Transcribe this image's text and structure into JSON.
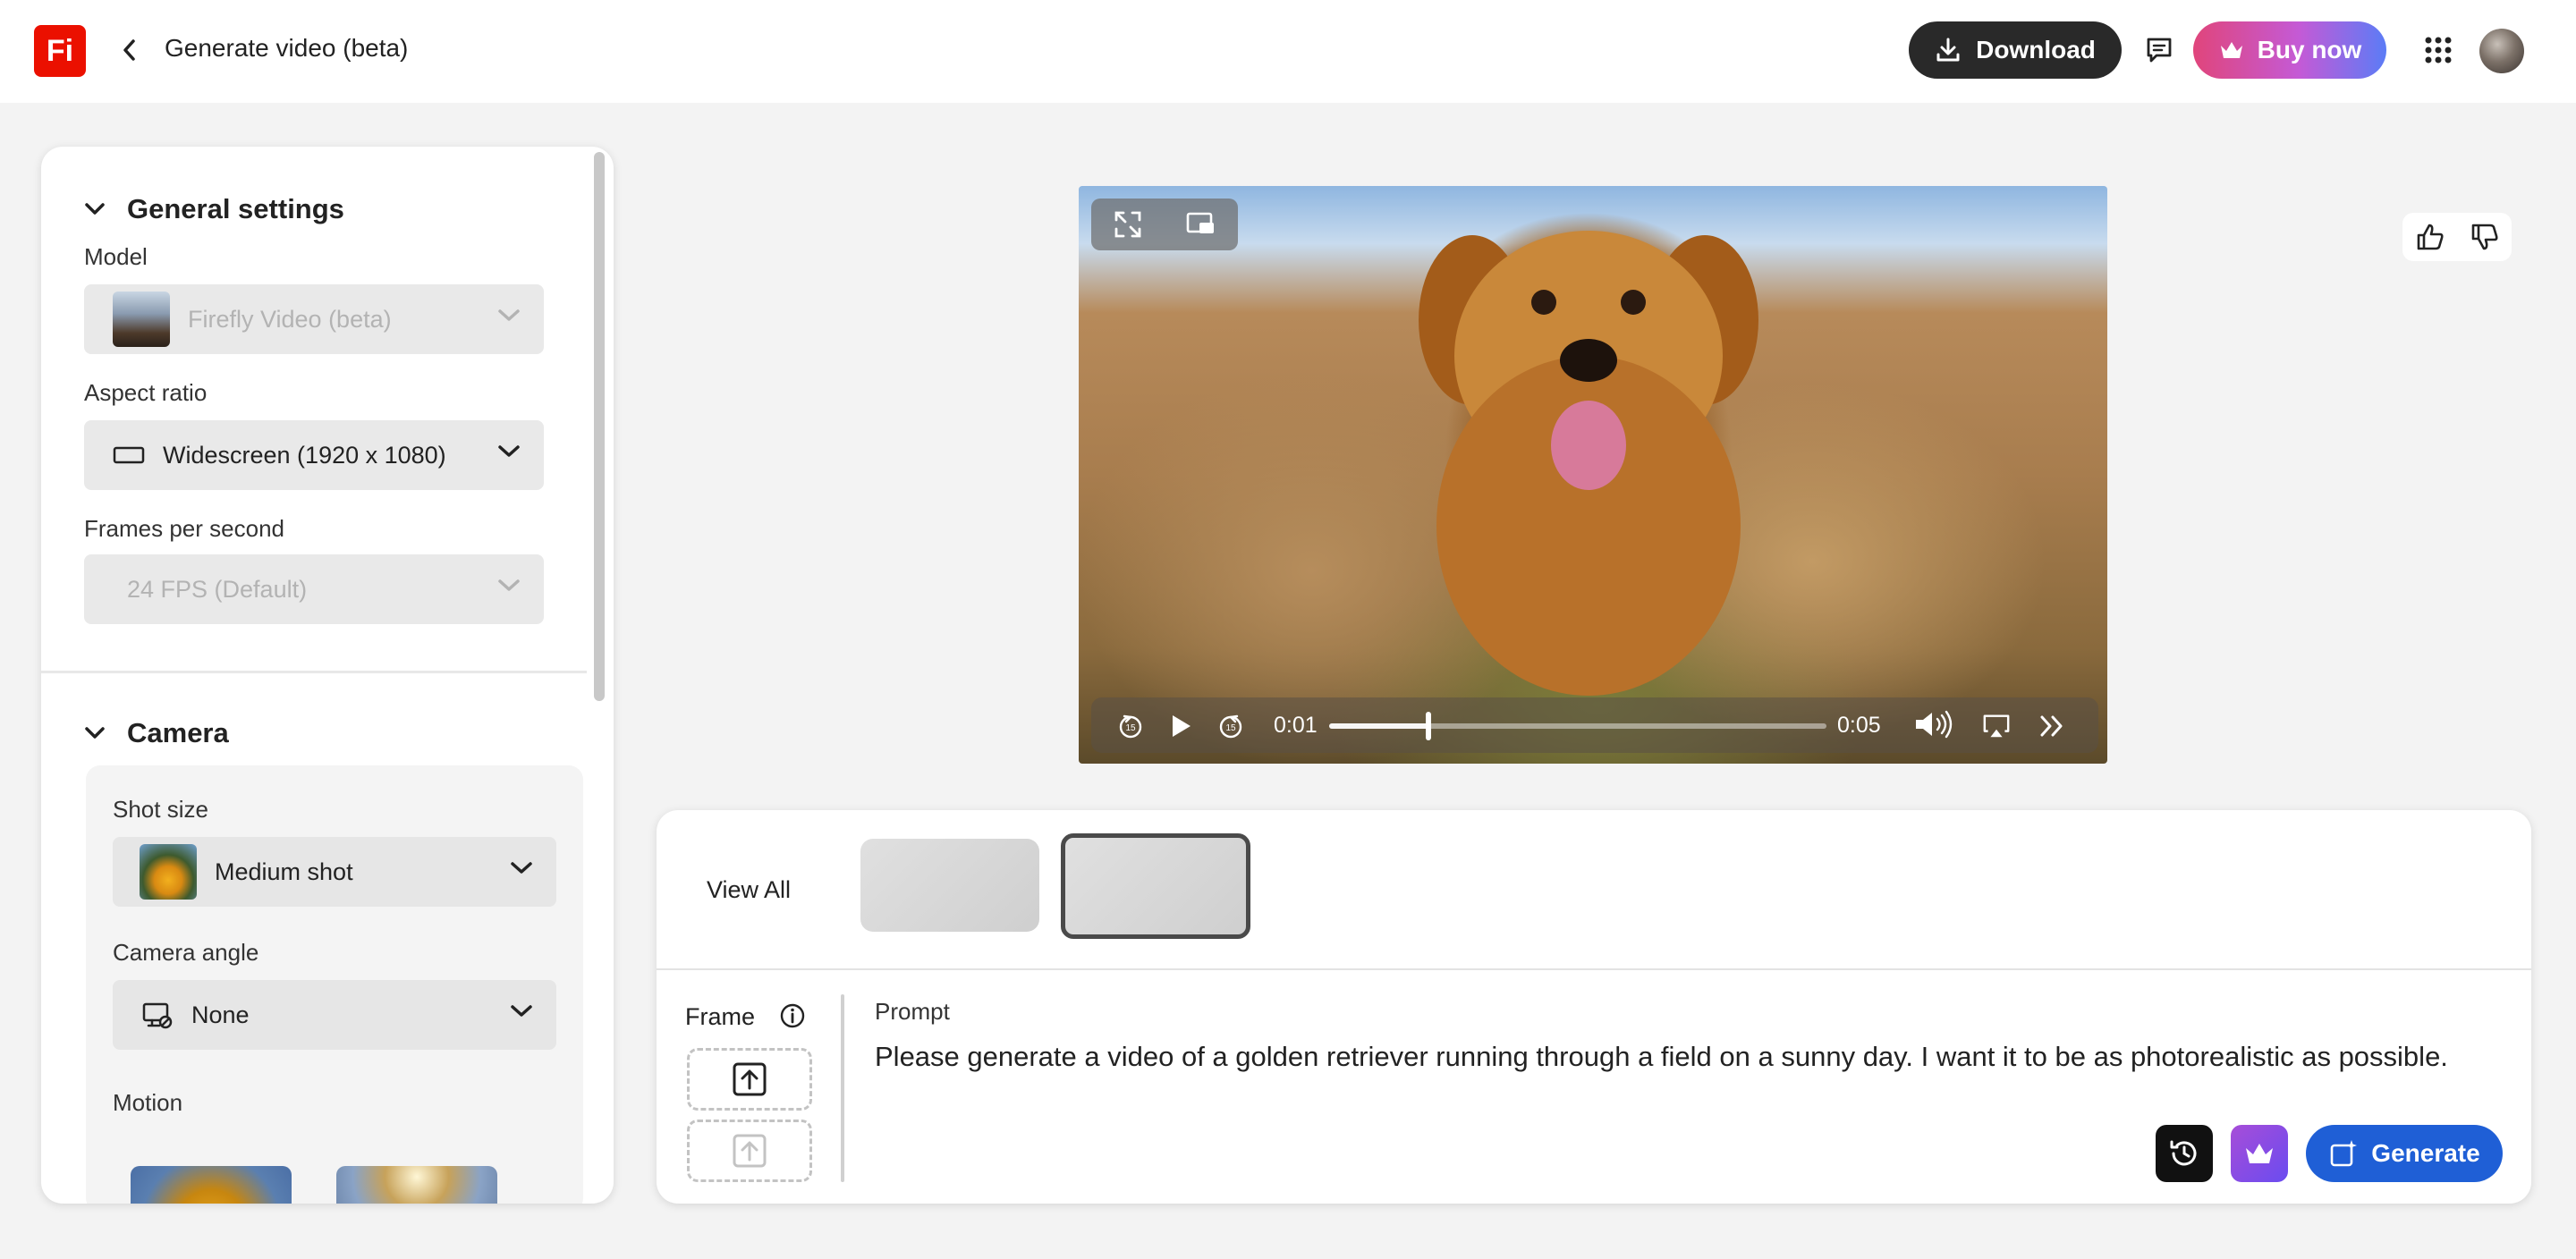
{
  "app": {
    "logo_text": "Fi",
    "page_title": "Generate video (beta)"
  },
  "header": {
    "download_label": "Download",
    "buy_label": "Buy now"
  },
  "general_settings": {
    "title": "General settings",
    "model_label": "Model",
    "model_value": "Firefly Video (beta)",
    "aspect_label": "Aspect ratio",
    "aspect_value": "Widescreen (1920 x 1080)",
    "fps_label": "Frames per second",
    "fps_value": "24 FPS (Default)"
  },
  "camera": {
    "title": "Camera",
    "shot_label": "Shot size",
    "shot_value": "Medium shot",
    "angle_label": "Camera angle",
    "angle_value": "None",
    "motion_label": "Motion"
  },
  "player": {
    "current_time": "0:01",
    "duration": "0:05",
    "progress": 0.2
  },
  "variations": {
    "view_all_label": "View All"
  },
  "prompt": {
    "frame_label": "Frame",
    "label": "Prompt",
    "text": "Please generate a video of a golden retriever running through a field on a sunny day. I want it to be as photorealistic as possible.",
    "generate_label": "Generate"
  },
  "colors": {
    "brand": "#eb1000",
    "generate": "#1f5fd6",
    "download_bg": "#292929"
  }
}
